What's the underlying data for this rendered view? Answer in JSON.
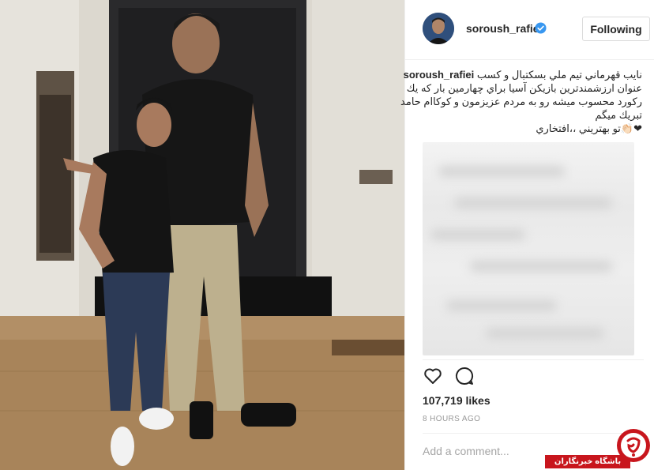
{
  "post": {
    "username": "soroush_rafiei",
    "follow_label": "Following",
    "caption_username": "soroush_rafiei",
    "caption_lines": [
      "نايب قهرماني تيم ملي بسكتبال و كسب",
      "عنوان ارزشمندترين بازيكن آسيا براي چهارمين بار كه يك",
      "ركورد محسوب ميشه رو به مردم عزيزمون و كوكاام حامد",
      "تبريك ميگم",
      "❤👏🏻تو بهتريني ،،افتخاري"
    ],
    "likes": "107,719 likes",
    "timestamp": "8 HOURS AGO",
    "comment_placeholder": "Add a comment..."
  },
  "icons": {
    "like": "heart-icon",
    "comment": "comment-icon",
    "verified": "verified-badge-icon"
  },
  "watermark": {
    "text": "باشگاه خبرنگاران"
  },
  "colors": {
    "verified_blue": "#3897f0",
    "watermark_red": "#c8161d",
    "muted_text": "#999999",
    "border": "#efefef"
  }
}
